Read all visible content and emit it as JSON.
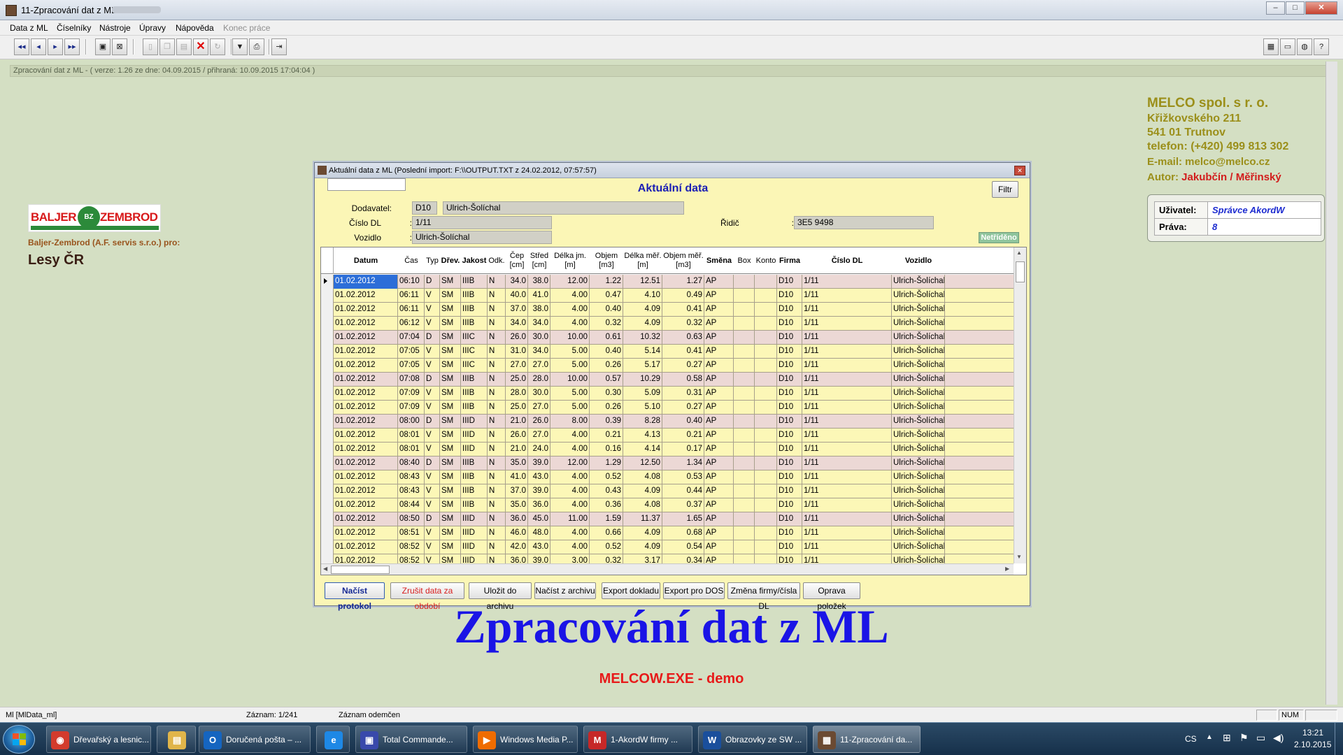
{
  "window": {
    "title": "11-Zpracování dat z ML"
  },
  "menu": [
    {
      "label": "Data z ML",
      "disabled": false
    },
    {
      "label": "Číselníky",
      "disabled": false
    },
    {
      "label": "Nástroje",
      "disabled": false
    },
    {
      "label": "Úpravy",
      "disabled": false
    },
    {
      "label": "Nápověda",
      "disabled": false
    },
    {
      "label": "Konec práce",
      "disabled": true
    }
  ],
  "toolbar": {
    "nav_icons": [
      "first-record-icon",
      "prev-record-icon",
      "next-record-icon",
      "last-record-icon"
    ],
    "nav_glyphs": [
      "◂◂",
      "◂",
      "▸",
      "▸▸"
    ],
    "edit_icons": [
      "save-icon",
      "cancel-edit-icon",
      "new-icon",
      "copy-icon",
      "paste-icon",
      "delete-icon",
      "refresh-icon",
      "filter-icon",
      "print-icon",
      "exit-icon"
    ],
    "right_icons": [
      "calculator-icon",
      "keyboard-icon",
      "globe-icon",
      "help-icon"
    ]
  },
  "infobar": {
    "text": "Zpracování dat z ML   -   ( verze: 1.26  ze dne: 04.09.2015  / přihraná: 10.09.2015 17:04:04 )"
  },
  "company": {
    "name": "MELCO spol. s r. o.",
    "lines": [
      "Křižkovského 211",
      "541 01 Trutnov",
      "telefon: (+420) 499 813 302"
    ],
    "email": "E-mail: melco@melco.cz",
    "author_label": "Autor:",
    "author": "Jakubčín / Měřinský"
  },
  "user": {
    "user_label": "Uživatel:",
    "user_value": "Správce AkordW",
    "rights_label": "Práva:",
    "rights_value": "8"
  },
  "logo": {
    "left": "BALJER",
    "mid": "BZ",
    "right": "ZEMBROD"
  },
  "left_info": {
    "company_line": "Baljer-Zembrod (A.F. servis s.r.o.) pro:",
    "client": "Lesy ČR"
  },
  "main_title": "Zpracování dat z ML",
  "demo_text": "MELCOW.EXE - demo",
  "dialog": {
    "title": "Aktuální data z ML (Poslední import: F:\\\\OUTPUT.TXT z 24.02.2012, 07:57:57)",
    "heading": "Aktuální data",
    "filter_button": "Filtr",
    "supplier_label": "Dodavatel:",
    "supplier_code": "D10",
    "supplier_name": "Ulrich-Šolíchal",
    "dl_label": "Číslo DL",
    "dl_value": "1/11",
    "vehicle_label": "Vozidlo",
    "vehicle_value": "Ulrich-Šolíchal",
    "driver_label": "Řidič",
    "driver_value": "3E5 9498",
    "sort_badge": "Netříděno",
    "columns": [
      {
        "key": "datum",
        "label": "Datum",
        "bold": true
      },
      {
        "key": "cas",
        "label": "Čas",
        "bold": false
      },
      {
        "key": "typ",
        "label": "Typ",
        "bold": false
      },
      {
        "key": "drev",
        "label": "Dřev.",
        "bold": true
      },
      {
        "key": "jakost",
        "label": "Jakost",
        "bold": true
      },
      {
        "key": "odk",
        "label": "Odk.",
        "bold": false
      },
      {
        "key": "cep",
        "label": "Čep [cm]",
        "bold": false
      },
      {
        "key": "stred",
        "label": "Střed [cm]",
        "bold": false
      },
      {
        "key": "delka_jm",
        "label": "Délka jm. [m]",
        "bold": false
      },
      {
        "key": "objem",
        "label": "Objem [m3]",
        "bold": false
      },
      {
        "key": "delka_mer",
        "label": "Délka měř. [m]",
        "bold": false
      },
      {
        "key": "objem_mer",
        "label": "Objem měř. [m3]",
        "bold": false
      },
      {
        "key": "smena",
        "label": "Směna",
        "bold": true
      },
      {
        "key": "box",
        "label": "Box",
        "bold": false
      },
      {
        "key": "konto",
        "label": "Konto",
        "bold": false
      },
      {
        "key": "firma",
        "label": "Firma",
        "bold": true
      },
      {
        "key": "cislo_dl",
        "label": "Číslo DL",
        "bold": true
      },
      {
        "key": "vozidlo",
        "label": "Vozidlo",
        "bold": true
      }
    ],
    "rows": [
      [
        "01.02.2012",
        "06:10",
        "D",
        "SM",
        "IIIB",
        "N",
        "34.0",
        "38.0",
        "12.00",
        "1.22",
        "12.51",
        "1.27",
        "AP",
        "",
        "",
        "D10",
        "1/11",
        "Ulrich-Šolíchal"
      ],
      [
        "01.02.2012",
        "06:11",
        "V",
        "SM",
        "IIIB",
        "N",
        "40.0",
        "41.0",
        "4.00",
        "0.47",
        "4.10",
        "0.49",
        "AP",
        "",
        "",
        "D10",
        "1/11",
        "Ulrich-Šolíchal"
      ],
      [
        "01.02.2012",
        "06:11",
        "V",
        "SM",
        "IIIB",
        "N",
        "37.0",
        "38.0",
        "4.00",
        "0.40",
        "4.09",
        "0.41",
        "AP",
        "",
        "",
        "D10",
        "1/11",
        "Ulrich-Šolíchal"
      ],
      [
        "01.02.2012",
        "06:12",
        "V",
        "SM",
        "IIIB",
        "N",
        "34.0",
        "34.0",
        "4.00",
        "0.32",
        "4.09",
        "0.32",
        "AP",
        "",
        "",
        "D10",
        "1/11",
        "Ulrich-Šolíchal"
      ],
      [
        "01.02.2012",
        "07:04",
        "D",
        "SM",
        "IIIC",
        "N",
        "26.0",
        "30.0",
        "10.00",
        "0.61",
        "10.32",
        "0.63",
        "AP",
        "",
        "",
        "D10",
        "1/11",
        "Ulrich-Šolíchal"
      ],
      [
        "01.02.2012",
        "07:05",
        "V",
        "SM",
        "IIIC",
        "N",
        "31.0",
        "34.0",
        "5.00",
        "0.40",
        "5.14",
        "0.41",
        "AP",
        "",
        "",
        "D10",
        "1/11",
        "Ulrich-Šolíchal"
      ],
      [
        "01.02.2012",
        "07:05",
        "V",
        "SM",
        "IIIC",
        "N",
        "27.0",
        "27.0",
        "5.00",
        "0.26",
        "5.17",
        "0.27",
        "AP",
        "",
        "",
        "D10",
        "1/11",
        "Ulrich-Šolíchal"
      ],
      [
        "01.02.2012",
        "07:08",
        "D",
        "SM",
        "IIIB",
        "N",
        "25.0",
        "28.0",
        "10.00",
        "0.57",
        "10.29",
        "0.58",
        "AP",
        "",
        "",
        "D10",
        "1/11",
        "Ulrich-Šolíchal"
      ],
      [
        "01.02.2012",
        "07:09",
        "V",
        "SM",
        "IIIB",
        "N",
        "28.0",
        "30.0",
        "5.00",
        "0.30",
        "5.09",
        "0.31",
        "AP",
        "",
        "",
        "D10",
        "1/11",
        "Ulrich-Šolíchal"
      ],
      [
        "01.02.2012",
        "07:09",
        "V",
        "SM",
        "IIIB",
        "N",
        "25.0",
        "27.0",
        "5.00",
        "0.26",
        "5.10",
        "0.27",
        "AP",
        "",
        "",
        "D10",
        "1/11",
        "Ulrich-Šolíchal"
      ],
      [
        "01.02.2012",
        "08:00",
        "D",
        "SM",
        "IIID",
        "N",
        "21.0",
        "26.0",
        "8.00",
        "0.39",
        "8.28",
        "0.40",
        "AP",
        "",
        "",
        "D10",
        "1/11",
        "Ulrich-Šolíchal"
      ],
      [
        "01.02.2012",
        "08:01",
        "V",
        "SM",
        "IIID",
        "N",
        "26.0",
        "27.0",
        "4.00",
        "0.21",
        "4.13",
        "0.21",
        "AP",
        "",
        "",
        "D10",
        "1/11",
        "Ulrich-Šolíchal"
      ],
      [
        "01.02.2012",
        "08:01",
        "V",
        "SM",
        "IIID",
        "N",
        "21.0",
        "24.0",
        "4.00",
        "0.16",
        "4.14",
        "0.17",
        "AP",
        "",
        "",
        "D10",
        "1/11",
        "Ulrich-Šolíchal"
      ],
      [
        "01.02.2012",
        "08:40",
        "D",
        "SM",
        "IIIB",
        "N",
        "35.0",
        "39.0",
        "12.00",
        "1.29",
        "12.50",
        "1.34",
        "AP",
        "",
        "",
        "D10",
        "1/11",
        "Ulrich-Šolíchal"
      ],
      [
        "01.02.2012",
        "08:43",
        "V",
        "SM",
        "IIIB",
        "N",
        "41.0",
        "43.0",
        "4.00",
        "0.52",
        "4.08",
        "0.53",
        "AP",
        "",
        "",
        "D10",
        "1/11",
        "Ulrich-Šolíchal"
      ],
      [
        "01.02.2012",
        "08:43",
        "V",
        "SM",
        "IIIB",
        "N",
        "37.0",
        "39.0",
        "4.00",
        "0.43",
        "4.09",
        "0.44",
        "AP",
        "",
        "",
        "D10",
        "1/11",
        "Ulrich-Šolíchal"
      ],
      [
        "01.02.2012",
        "08:44",
        "V",
        "SM",
        "IIIB",
        "N",
        "35.0",
        "36.0",
        "4.00",
        "0.36",
        "4.08",
        "0.37",
        "AP",
        "",
        "",
        "D10",
        "1/11",
        "Ulrich-Šolíchal"
      ],
      [
        "01.02.2012",
        "08:50",
        "D",
        "SM",
        "IIID",
        "N",
        "36.0",
        "45.0",
        "11.00",
        "1.59",
        "11.37",
        "1.65",
        "AP",
        "",
        "",
        "D10",
        "1/11",
        "Ulrich-Šolíchal"
      ],
      [
        "01.02.2012",
        "08:51",
        "V",
        "SM",
        "IIID",
        "N",
        "46.0",
        "48.0",
        "4.00",
        "0.66",
        "4.09",
        "0.68",
        "AP",
        "",
        "",
        "D10",
        "1/11",
        "Ulrich-Šolíchal"
      ],
      [
        "01.02.2012",
        "08:52",
        "V",
        "SM",
        "IIID",
        "N",
        "42.0",
        "43.0",
        "4.00",
        "0.52",
        "4.09",
        "0.54",
        "AP",
        "",
        "",
        "D10",
        "1/11",
        "Ulrich-Šolíchal"
      ],
      [
        "01.02.2012",
        "08:52",
        "V",
        "SM",
        "IIID",
        "N",
        "36.0",
        "39.0",
        "3.00",
        "0.32",
        "3.17",
        "0.34",
        "AP",
        "",
        "",
        "D10",
        "1/11",
        "Ulrich-Šolíchal"
      ]
    ],
    "buttons": [
      "Načíst protokol",
      "Zrušit data za období",
      "Uložit do archivu",
      "Načíst z archivu",
      "Export dokladu",
      "Export pro DOS",
      "Změna firmy/čísla DL",
      "Oprava položek"
    ]
  },
  "statusbar": {
    "left": "Ml [MlData_ml]",
    "record": "Záznam: 1/241",
    "lock": "Záznam odemčen",
    "num": "NUM"
  },
  "taskbar": {
    "items": [
      {
        "label": "Dřevařský a lesnic...",
        "icon": "chrome-icon",
        "glyph": "◉",
        "color": "#d33b2c"
      },
      {
        "label": "",
        "icon": "folder-icon",
        "glyph": "▤",
        "color": "#e0b54a"
      },
      {
        "label": "Doručená pošta – ...",
        "icon": "outlook-icon",
        "glyph": "O",
        "color": "#1565c0"
      },
      {
        "label": "",
        "icon": "ie-icon",
        "glyph": "e",
        "color": "#1e88e5"
      },
      {
        "label": "Total Commande...",
        "icon": "total-commander-icon",
        "glyph": "▣",
        "color": "#3949ab"
      },
      {
        "label": "Windows Media P...",
        "icon": "media-player-icon",
        "glyph": "▶",
        "color": "#ef6c00"
      },
      {
        "label": "1-AkordW firmy ...",
        "icon": "melco-icon",
        "glyph": "M",
        "color": "#c62828"
      },
      {
        "label": "Obrazovky ze SW ...",
        "icon": "word-icon",
        "glyph": "W",
        "color": "#1a4f9c"
      },
      {
        "label": "11-Zpracování da...",
        "icon": "app-icon",
        "glyph": "▦",
        "color": "#6b4a32"
      }
    ],
    "lang": "CS",
    "time": "13:21",
    "date": "2.10.2015"
  }
}
